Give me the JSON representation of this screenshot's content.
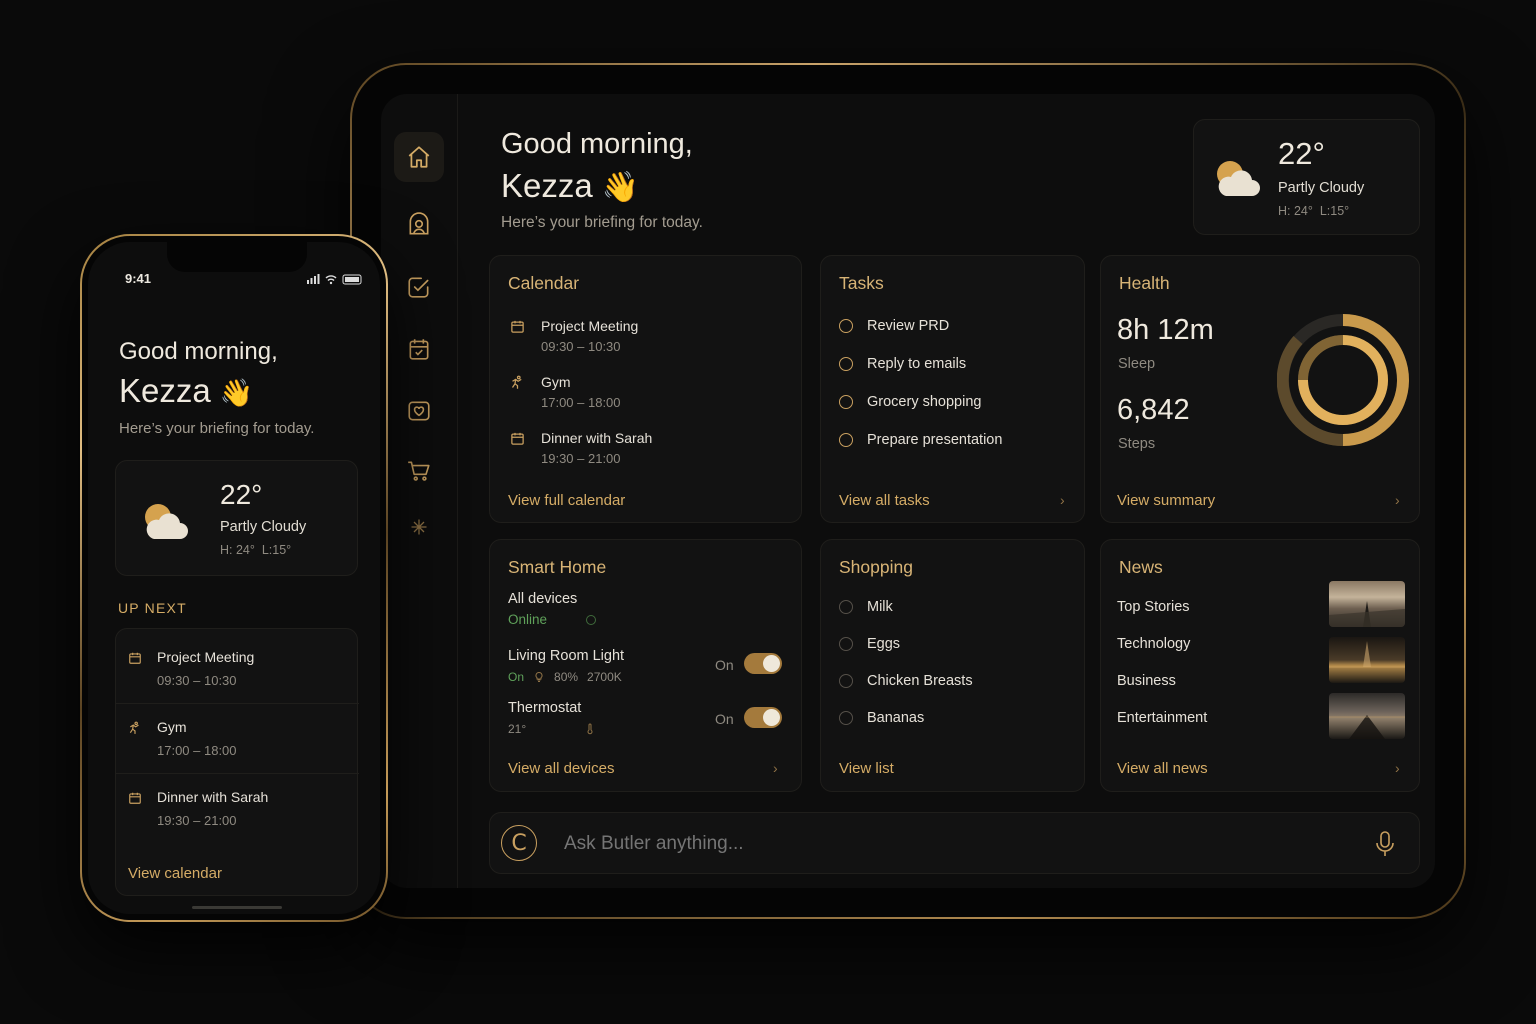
{
  "tablet": {
    "greeting_line1": "Good morning,",
    "greeting_name": "Kezza",
    "greeting_emoji": "👋",
    "greeting_sub": "Here’s your briefing for today.",
    "sidebar": [
      {
        "icon": "home-icon"
      },
      {
        "icon": "butler-icon"
      },
      {
        "icon": "tasks-icon"
      },
      {
        "icon": "calendar-icon"
      },
      {
        "icon": "health-icon"
      },
      {
        "icon": "cart-icon"
      },
      {
        "icon": "sparkle-icon"
      }
    ],
    "weather": {
      "temp": "22°",
      "condition": "Partly Cloudy",
      "hi": "H: 24°",
      "lo": "L:15°"
    },
    "calendar": {
      "title": "Calendar",
      "events": [
        {
          "title": "Project Meeting",
          "time": "09:30 – 10:30",
          "icon": "calendar-icon"
        },
        {
          "title": "Gym",
          "time": "17:00 – 18:00",
          "icon": "gym-icon"
        },
        {
          "title": "Dinner with Sarah",
          "time": "19:30 – 21:00",
          "icon": "calendar-icon"
        }
      ],
      "link": "View full calendar"
    },
    "tasks": {
      "title": "Tasks",
      "items": [
        "Review PRD",
        "Reply to emails",
        "Grocery shopping",
        "Prepare presentation"
      ],
      "link": "View all tasks"
    },
    "health": {
      "title": "Health",
      "sleep_value": "8h 12m",
      "sleep_label": "Sleep",
      "steps_value": "6,842",
      "steps_label": "Steps",
      "link": "View summary"
    },
    "smart_home": {
      "title": "Smart Home",
      "all_devices": "All devices",
      "status": "Online",
      "devices": [
        {
          "name": "Living Room Light",
          "state": "On",
          "detail1": "On",
          "detail2": "80%",
          "detail3": "2700K",
          "toggle_label": "On"
        },
        {
          "name": "Thermostat",
          "detail1": "21°",
          "toggle_label": "On"
        }
      ],
      "link": "View all devices"
    },
    "shopping": {
      "title": "Shopping",
      "items": [
        "Milk",
        "Eggs",
        "Chicken Breasts",
        "Bananas"
      ],
      "link": "View list"
    },
    "news": {
      "title": "News",
      "categories": [
        "Top Stories",
        "Technology",
        "Business",
        "Entertainment"
      ],
      "link": "View all news"
    },
    "assistant": {
      "placeholder": "Ask Butler anything...",
      "logo": "C"
    }
  },
  "phone": {
    "time": "9:41",
    "greeting_line1": "Good morning,",
    "greeting_name": "Kezza",
    "greeting_emoji": "👋",
    "greeting_sub": "Here’s your briefing for today.",
    "weather": {
      "temp": "22°",
      "condition": "Partly Cloudy",
      "hi": "H: 24°",
      "lo": "L:15°"
    },
    "up_next_label": "UP NEXT",
    "events": [
      {
        "title": "Project Meeting",
        "time": "09:30 – 10:30"
      },
      {
        "title": "Gym",
        "time": "17:00 – 18:00"
      },
      {
        "title": "Dinner with Sarah",
        "time": "19:30 – 21:00"
      }
    ],
    "link": "View calendar"
  },
  "colors": {
    "accent": "#d5ac66",
    "background": "#0a0a0a",
    "card": "#121212",
    "online": "#5fa15a"
  }
}
